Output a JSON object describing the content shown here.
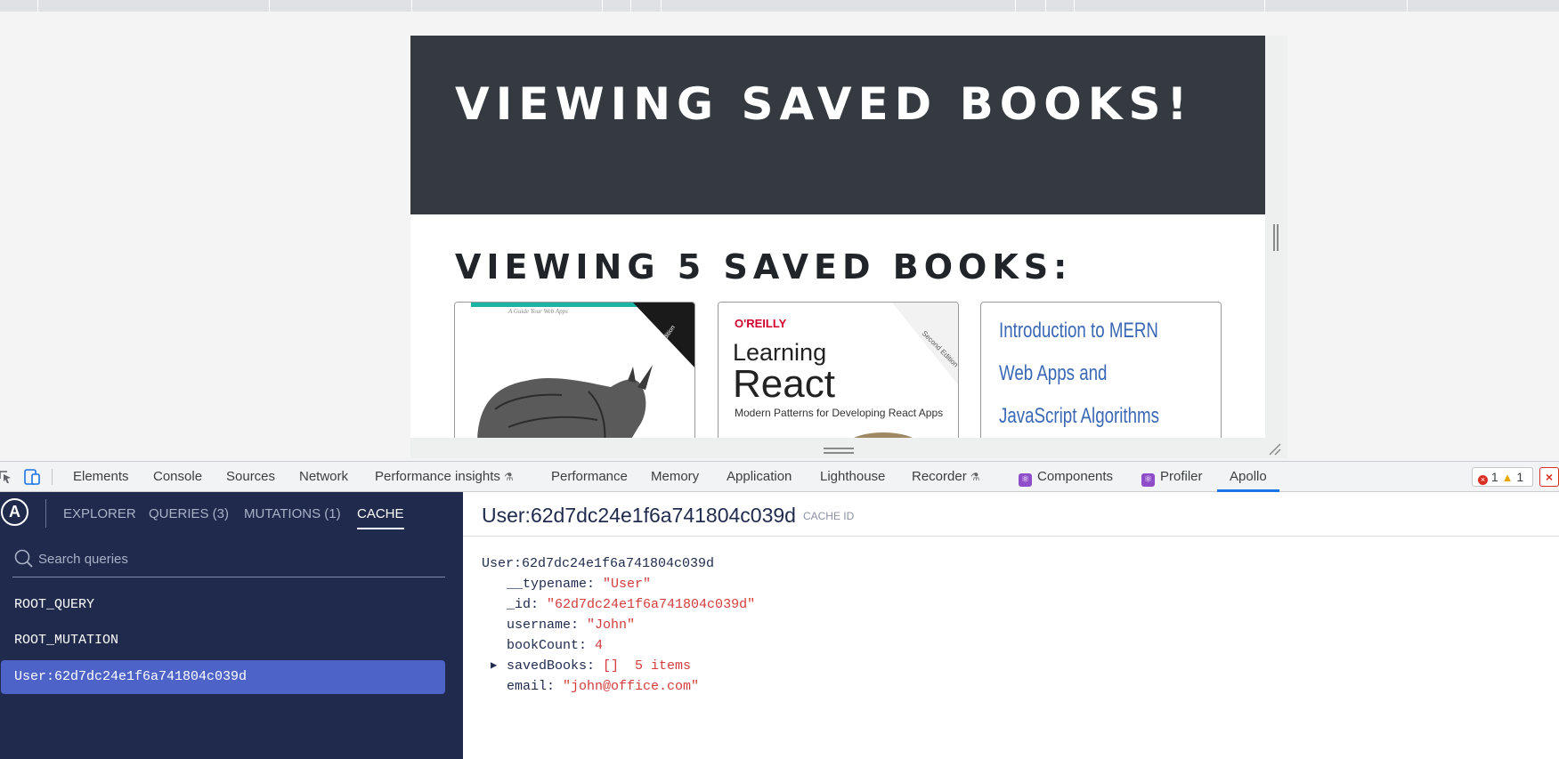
{
  "page": {
    "hero_title": "VIEWING SAVED BOOKS!",
    "subtitle": "VIEWING 5 SAVED BOOKS:",
    "books": [
      {
        "cover_lines": [
          "A Guide Your Web Apps",
          "3rd Edition"
        ]
      },
      {
        "publisher": "O'REILLY",
        "title_line1": "Learning",
        "title_line2": "React",
        "tagline": "Modern Patterns for Developing React Apps",
        "edition": "Second Edition"
      },
      {
        "title": "Introduction to MERN Web Apps and JavaScript Algorithms"
      }
    ]
  },
  "devtools": {
    "tabs": [
      "Elements",
      "Console",
      "Sources",
      "Network",
      "Performance insights",
      "Performance",
      "Memory",
      "Application",
      "Lighthouse",
      "Recorder",
      "Components",
      "Profiler",
      "Apollo"
    ],
    "active_tab": "Apollo",
    "errors": "1",
    "warnings": "1"
  },
  "apollo": {
    "logo": "A",
    "nav": [
      "EXPLORER",
      "QUERIES (3)",
      "MUTATIONS (1)",
      "CACHE"
    ],
    "active_nav": "CACHE",
    "search_placeholder": "Search queries",
    "cache_items": [
      "ROOT_QUERY",
      "ROOT_MUTATION",
      "User:62d7dc24e1f6a741804c039d"
    ],
    "selected_item": "User:62d7dc24e1f6a741804c039d",
    "header_title": "User:62d7dc24e1f6a741804c039d",
    "cache_id_label": "CACHE ID",
    "tree": {
      "root": "User:62d7dc24e1f6a741804c039d",
      "typename_key": "__typename:",
      "typename_val": "\"User\"",
      "id_key": "_id:",
      "id_val": "\"62d7dc24e1f6a741804c039d\"",
      "username_key": "username:",
      "username_val": "\"John\"",
      "bookcount_key": "bookCount:",
      "bookcount_val": "4",
      "savedbooks_key": "savedBooks:",
      "savedbooks_val": "[]  5 items",
      "email_key": "email:",
      "email_val": "\"john@office.com\""
    }
  },
  "colors": {
    "hero_bg": "#343a40",
    "sidebar_bg": "#1f2a4d",
    "selected_bg": "#4d63c8",
    "string_value": "#d43c3c",
    "active_tab_underline": "#1a73e8"
  }
}
